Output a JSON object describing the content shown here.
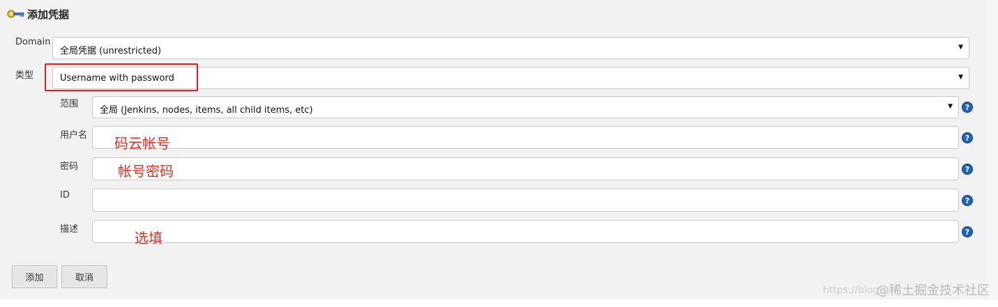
{
  "header": {
    "title": "添加凭据",
    "icon": "key-icon"
  },
  "form": {
    "domain": {
      "label": "Domain",
      "value": "全局凭据 (unrestricted)"
    },
    "kind": {
      "label": "类型",
      "value": "Username with password"
    },
    "scope": {
      "label": "范围",
      "value": "全局 (Jenkins, nodes, items, all child items, etc)"
    },
    "username": {
      "label": "用户名",
      "value": ""
    },
    "password": {
      "label": "密码",
      "value": ""
    },
    "id": {
      "label": "ID",
      "value": ""
    },
    "description": {
      "label": "描述",
      "value": ""
    },
    "help_glyph": "?"
  },
  "annotations": {
    "username_note": "码云帐号",
    "password_note": "帐号密码",
    "description_note": "选填",
    "highlight_color": "#e02020"
  },
  "buttons": {
    "add": "添加",
    "cancel": "取消"
  },
  "watermark": {
    "url": "https://blog.",
    "site": "@稀土掘金技术社区"
  }
}
